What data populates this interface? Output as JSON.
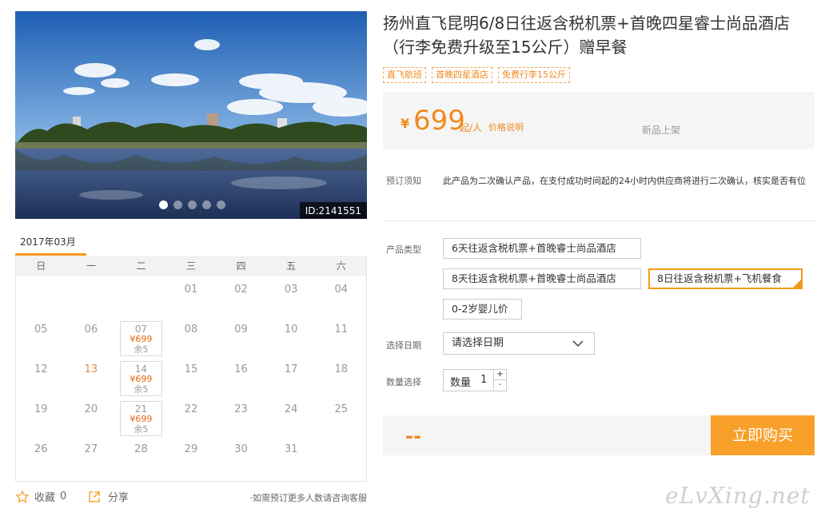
{
  "photo": {
    "id_label": "ID:2141551",
    "slides": 5,
    "active_slide": 0,
    "colors": {
      "sky_top": "#1f5fb3",
      "sky_bottom": "#8ab8e6",
      "water": "#27406e",
      "trees": "#2f4a1f"
    }
  },
  "calendar": {
    "month": "2017年03月",
    "weekdays": [
      "日",
      "一",
      "二",
      "三",
      "四",
      "五",
      "六"
    ],
    "cells": [
      {
        "day": ""
      },
      {
        "day": ""
      },
      {
        "day": ""
      },
      {
        "day": "01"
      },
      {
        "day": "02"
      },
      {
        "day": "03"
      },
      {
        "day": "04"
      },
      {
        "day": "05"
      },
      {
        "day": "06"
      },
      {
        "day": "07",
        "price": "¥699",
        "stock": "余5"
      },
      {
        "day": "08"
      },
      {
        "day": "09"
      },
      {
        "day": "10"
      },
      {
        "day": "11"
      },
      {
        "day": "12"
      },
      {
        "day": "13",
        "highlight": true
      },
      {
        "day": "14",
        "price": "¥699",
        "stock": "余5"
      },
      {
        "day": "15"
      },
      {
        "day": "16"
      },
      {
        "day": "17"
      },
      {
        "day": "18"
      },
      {
        "day": "19"
      },
      {
        "day": "20"
      },
      {
        "day": "21",
        "price": "¥699",
        "stock": "余5"
      },
      {
        "day": "22"
      },
      {
        "day": "23"
      },
      {
        "day": "24"
      },
      {
        "day": "25"
      },
      {
        "day": "26"
      },
      {
        "day": "27"
      },
      {
        "day": "28"
      },
      {
        "day": "29"
      },
      {
        "day": "30"
      },
      {
        "day": "31"
      }
    ]
  },
  "actions": {
    "favorite_label": "收藏",
    "favorite_count": "0",
    "share_label": "分享",
    "consult_text": "如需预订更多人数请咨询客服"
  },
  "product": {
    "title": "扬州直飞昆明6/8日往返含税机票+首晚四星睿士尚品酒店（行李免费升级至15公斤）赠早餐",
    "tags": [
      "直飞航班",
      "首晚四星酒店",
      "免费行李15公斤"
    ],
    "price_currency": "¥",
    "price": "699",
    "price_unit": "起/人",
    "price_note": "价格说明",
    "status": "新品上架",
    "notice_label": "预订须知",
    "notice_text": "此产品为二次确认产品，在支付成功时间起的24小时内供应商将进行二次确认，核实是否有位"
  },
  "booking": {
    "type_label": "产品类型",
    "types": [
      "6天往返含税机票+首晚睿士尚品酒店",
      "8天往返含税机票+首晚睿士尚品酒店",
      "8日往返含税机票+飞机餐食",
      "0-2岁婴儿价"
    ],
    "selected_type": 2,
    "date_label": "选择日期",
    "date_placeholder": "请选择日期",
    "qty_label": "数量选择",
    "qty_text": "数量",
    "qty_value": "1",
    "qty_plus": "+",
    "qty_minus": "-",
    "total": "--",
    "buy_label": "立即购买"
  },
  "watermark": "eLvXing.net",
  "colors": {
    "accent": "#f08a1d",
    "button": "#f8a02a"
  }
}
